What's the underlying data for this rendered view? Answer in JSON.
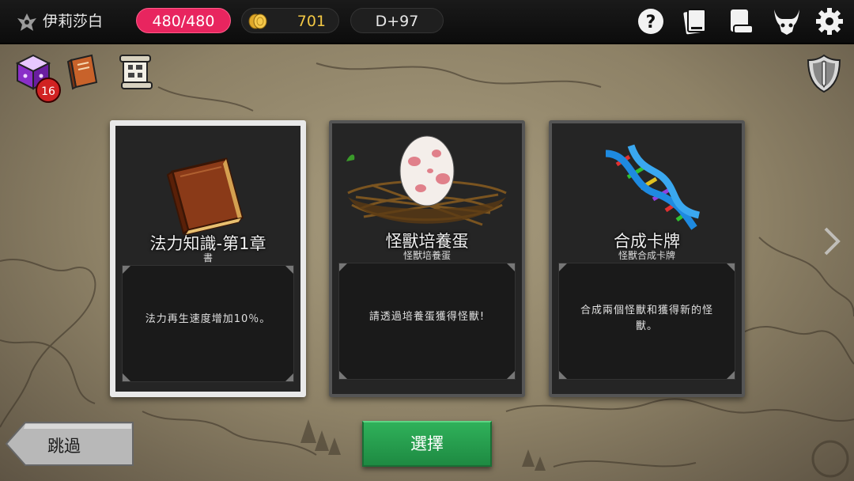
{
  "header": {
    "player_name": "伊莉莎白",
    "hp": "480/480",
    "gold": "701",
    "day": "D+97"
  },
  "icons": {
    "help": "help-icon",
    "cards": "cards-icon",
    "scroll": "scroll-icon",
    "monster": "monster-horns-icon",
    "settings": "gear-icon"
  },
  "inventory": {
    "cube_badge_count": "16"
  },
  "cards": [
    {
      "title": "法力知識-第1章",
      "subtitle": "書",
      "description": "法力再生速度增加10％。",
      "selected": true
    },
    {
      "title": "怪獸培養蛋",
      "subtitle": "怪獸培養蛋",
      "description": "請透過培養蛋獲得怪獸!",
      "selected": false
    },
    {
      "title": "合成卡牌",
      "subtitle": "怪獸合成卡牌",
      "description": "合成兩個怪獸和獲得新的怪獸。",
      "selected": false
    }
  ],
  "buttons": {
    "skip_label": "跳過",
    "select_label": "選擇"
  },
  "colors": {
    "hp_pill": "#e8255f",
    "gold_text": "#f2c744",
    "select_button": "#2fb15a",
    "skip_button": "#b8b8b8"
  }
}
